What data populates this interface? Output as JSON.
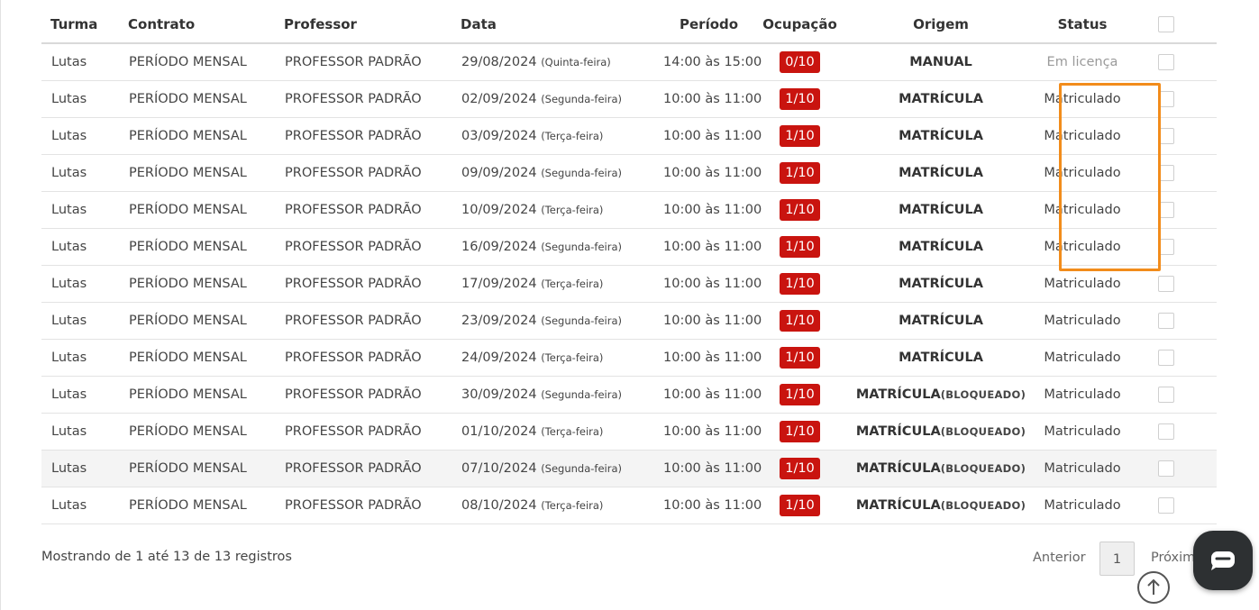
{
  "table": {
    "headers": {
      "turma": "Turma",
      "contrato": "Contrato",
      "professor": "Professor",
      "data": "Data",
      "periodo": "Período",
      "ocupacao": "Ocupação",
      "origem": "Origem",
      "status": "Status"
    },
    "rows": [
      {
        "turma": "Lutas",
        "contrato": "PERÍODO MENSAL",
        "professor": "PROFESSOR PADRÃO",
        "date": "29/08/2024",
        "weekday": "(Quinta-feira)",
        "periodo": "14:00 às 15:00",
        "ocupacao": "0/10",
        "origem": "MANUAL",
        "origem_sub": "",
        "status": "Em licença"
      },
      {
        "turma": "Lutas",
        "contrato": "PERÍODO MENSAL",
        "professor": "PROFESSOR PADRÃO",
        "date": "02/09/2024",
        "weekday": "(Segunda-feira)",
        "periodo": "10:00 às 11:00",
        "ocupacao": "1/10",
        "origem": "MATRÍCULA",
        "origem_sub": "",
        "status": "Matriculado"
      },
      {
        "turma": "Lutas",
        "contrato": "PERÍODO MENSAL",
        "professor": "PROFESSOR PADRÃO",
        "date": "03/09/2024",
        "weekday": "(Terça-feira)",
        "periodo": "10:00 às 11:00",
        "ocupacao": "1/10",
        "origem": "MATRÍCULA",
        "origem_sub": "",
        "status": "Matriculado"
      },
      {
        "turma": "Lutas",
        "contrato": "PERÍODO MENSAL",
        "professor": "PROFESSOR PADRÃO",
        "date": "09/09/2024",
        "weekday": "(Segunda-feira)",
        "periodo": "10:00 às 11:00",
        "ocupacao": "1/10",
        "origem": "MATRÍCULA",
        "origem_sub": "",
        "status": "Matriculado"
      },
      {
        "turma": "Lutas",
        "contrato": "PERÍODO MENSAL",
        "professor": "PROFESSOR PADRÃO",
        "date": "10/09/2024",
        "weekday": "(Terça-feira)",
        "periodo": "10:00 às 11:00",
        "ocupacao": "1/10",
        "origem": "MATRÍCULA",
        "origem_sub": "",
        "status": "Matriculado"
      },
      {
        "turma": "Lutas",
        "contrato": "PERÍODO MENSAL",
        "professor": "PROFESSOR PADRÃO",
        "date": "16/09/2024",
        "weekday": "(Segunda-feira)",
        "periodo": "10:00 às 11:00",
        "ocupacao": "1/10",
        "origem": "MATRÍCULA",
        "origem_sub": "",
        "status": "Matriculado"
      },
      {
        "turma": "Lutas",
        "contrato": "PERÍODO MENSAL",
        "professor": "PROFESSOR PADRÃO",
        "date": "17/09/2024",
        "weekday": "(Terça-feira)",
        "periodo": "10:00 às 11:00",
        "ocupacao": "1/10",
        "origem": "MATRÍCULA",
        "origem_sub": "",
        "status": "Matriculado"
      },
      {
        "turma": "Lutas",
        "contrato": "PERÍODO MENSAL",
        "professor": "PROFESSOR PADRÃO",
        "date": "23/09/2024",
        "weekday": "(Segunda-feira)",
        "periodo": "10:00 às 11:00",
        "ocupacao": "1/10",
        "origem": "MATRÍCULA",
        "origem_sub": "",
        "status": "Matriculado"
      },
      {
        "turma": "Lutas",
        "contrato": "PERÍODO MENSAL",
        "professor": "PROFESSOR PADRÃO",
        "date": "24/09/2024",
        "weekday": "(Terça-feira)",
        "periodo": "10:00 às 11:00",
        "ocupacao": "1/10",
        "origem": "MATRÍCULA",
        "origem_sub": "",
        "status": "Matriculado"
      },
      {
        "turma": "Lutas",
        "contrato": "PERÍODO MENSAL",
        "professor": "PROFESSOR PADRÃO",
        "date": "30/09/2024",
        "weekday": "(Segunda-feira)",
        "periodo": "10:00 às 11:00",
        "ocupacao": "1/10",
        "origem": "MATRÍCULA",
        "origem_sub": "(BLOQUEADO)",
        "status": "Matriculado"
      },
      {
        "turma": "Lutas",
        "contrato": "PERÍODO MENSAL",
        "professor": "PROFESSOR PADRÃO",
        "date": "01/10/2024",
        "weekday": "(Terça-feira)",
        "periodo": "10:00 às 11:00",
        "ocupacao": "1/10",
        "origem": "MATRÍCULA",
        "origem_sub": "(BLOQUEADO)",
        "status": "Matriculado"
      },
      {
        "turma": "Lutas",
        "contrato": "PERÍODO MENSAL",
        "professor": "PROFESSOR PADRÃO",
        "date": "07/10/2024",
        "weekday": "(Segunda-feira)",
        "periodo": "10:00 às 11:00",
        "ocupacao": "1/10",
        "origem": "MATRÍCULA",
        "origem_sub": "(BLOQUEADO)",
        "status": "Matriculado"
      },
      {
        "turma": "Lutas",
        "contrato": "PERÍODO MENSAL",
        "professor": "PROFESSOR PADRÃO",
        "date": "08/10/2024",
        "weekday": "(Terça-feira)",
        "periodo": "10:00 às 11:00",
        "ocupacao": "1/10",
        "origem": "MATRÍCULA",
        "origem_sub": "(BLOQUEADO)",
        "status": "Matriculado"
      }
    ]
  },
  "footer": {
    "info": "Mostrando de 1 até 13 de 13 registros",
    "prev": "Anterior",
    "page": "1",
    "next": "Próximo"
  },
  "icons": {
    "scroll_top": "arrow-up-circle-icon",
    "chat": "chat-bubble-icon"
  },
  "colors": {
    "badge": "#c9140f",
    "highlight_outline": "#f28c1b",
    "chat_button": "#2d3032"
  }
}
